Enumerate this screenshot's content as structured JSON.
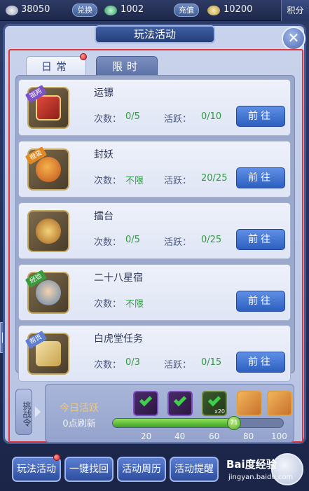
{
  "topbar": {
    "silver": "38050",
    "exchange_label": "兑换",
    "jade": "1002",
    "recharge_label": "充值",
    "gold": "10200",
    "score_tab": "积分"
  },
  "panel": {
    "title": "玩法活动",
    "close": "✕"
  },
  "tabs": [
    {
      "label": "日常",
      "active": true
    },
    {
      "label": "限时",
      "active": false
    }
  ],
  "activities": [
    {
      "name": "运镖",
      "tag": "银两",
      "count_label": "次数：",
      "count": "0/5",
      "active_label": "活跃：",
      "active": "0/10",
      "button": "前往"
    },
    {
      "name": "封妖",
      "tag": "橙装",
      "count_label": "次数：",
      "count": "不限",
      "active_label": "活跃：",
      "active": "20/25",
      "button": "前往"
    },
    {
      "name": "擂台",
      "tag": "",
      "count_label": "次数：",
      "count": "0/5",
      "active_label": "活跃：",
      "active": "0/25",
      "button": "前往"
    },
    {
      "name": "二十八星宿",
      "tag": "经验",
      "count_label": "次数：",
      "count": "不限",
      "active_label": "",
      "active": "",
      "button": "前往"
    },
    {
      "name": "白虎堂任务",
      "tag": "帮贡",
      "count_label": "次数：",
      "count": "0/3",
      "active_label": "活跃：",
      "active": "0/15",
      "button": "前往"
    }
  ],
  "activity_progress": {
    "challenge_label": "挑战令",
    "today_label": "今日活跃",
    "refresh_label": "0点刷新",
    "current": "71",
    "max": 100,
    "ticks": [
      "20",
      "40",
      "60",
      "80",
      "100"
    ],
    "chest_badge": "x20"
  },
  "bottom_nav": [
    "玩法活动",
    "一键找回",
    "活动周历",
    "活动提醒"
  ],
  "watermark": {
    "brand": "Bai度经验",
    "url": "jingyan.baidu.com"
  },
  "colors": {
    "accent_green": "#2f9a41",
    "button_blue": "#2d5fbf",
    "frame_red": "#e23434"
  }
}
